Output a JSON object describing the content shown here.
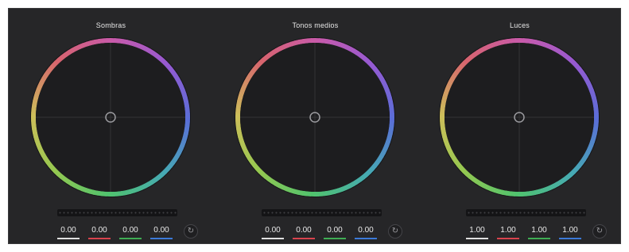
{
  "colors": {
    "panel_bg": "#262628",
    "wheel_inner": "#1d1d1f",
    "y_underline": "#e0e0e0",
    "r_underline": "#d9434d",
    "g_underline": "#3fae54",
    "b_underline": "#3c7ad9"
  },
  "wheels": [
    {
      "title": "Sombras",
      "values": {
        "y": "0.00",
        "r": "0.00",
        "g": "0.00",
        "b": "0.00"
      },
      "reset_icon": "reset-icon"
    },
    {
      "title": "Tonos medios",
      "values": {
        "y": "0.00",
        "r": "0.00",
        "g": "0.00",
        "b": "0.00"
      },
      "reset_icon": "reset-icon"
    },
    {
      "title": "Luces",
      "values": {
        "y": "1.00",
        "r": "1.00",
        "g": "1.00",
        "b": "1.00"
      },
      "reset_icon": "reset-icon"
    }
  ]
}
